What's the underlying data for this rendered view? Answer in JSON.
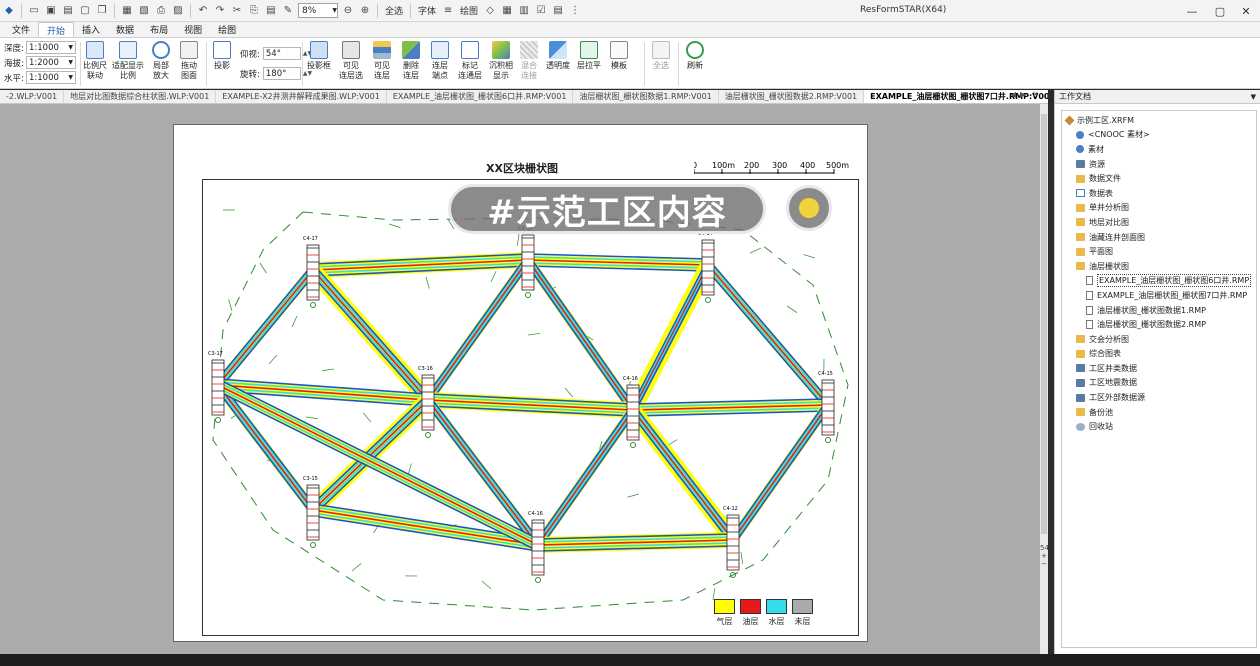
{
  "app": {
    "title": "ResFormSTAR(X64)"
  },
  "toolbar": {
    "zoom": "8%",
    "select_all": "全选",
    "font": "字体",
    "draw": "绘图"
  },
  "menu": {
    "tabs": [
      "文件",
      "开始",
      "插入",
      "数据",
      "布局",
      "视图",
      "绘图"
    ],
    "active": 1
  },
  "ribbon": {
    "depth_label": "深度:",
    "depth": "1:1000",
    "elev_label": "海拔:",
    "elev": "1:2000",
    "horiz_label": "水平:",
    "horiz": "1:1000",
    "pitch_label": "仰视:",
    "pitch": "54°",
    "rot_label": "旋转:",
    "rot": "180°",
    "buttons": [
      {
        "l1": "比例尺",
        "l2": "联动"
      },
      {
        "l1": "适配显示",
        "l2": "比例"
      },
      {
        "l1": "局部",
        "l2": "放大"
      },
      {
        "l1": "拖动",
        "l2": "图面"
      },
      {
        "l1": "投影",
        "l2": ""
      },
      {
        "l1": "投影框",
        "l2": ""
      },
      {
        "l1": "可见",
        "l2": "连层选"
      },
      {
        "l1": "可见",
        "l2": "连层"
      },
      {
        "l1": "删除",
        "l2": "连层"
      },
      {
        "l1": "连层",
        "l2": "端点"
      },
      {
        "l1": "标记",
        "l2": "连通层"
      },
      {
        "l1": "沉积相",
        "l2": "显示"
      },
      {
        "l1": "混合",
        "l2": "连接"
      },
      {
        "l1": "透明度",
        "l2": ""
      },
      {
        "l1": "层拉平",
        "l2": ""
      },
      {
        "l1": "模板",
        "l2": ""
      },
      {
        "l1": "全选",
        "l2": ""
      },
      {
        "l1": "刷新",
        "l2": ""
      }
    ]
  },
  "doc_tabs": [
    "-2.WLP:V001",
    "地层对比图数据综合柱状图.WLP:V001",
    "EXAMPLE-X2井测井解释成果图.WLP:V001",
    "EXAMPLE_油层栅状图_栅状图6口井.RMP:V001",
    "油层栅状图_栅状图数据1.RMP:V001",
    "油层栅状图_栅状图数据2.RMP:V001",
    "EXAMPLE_油层栅状图_栅状图7口井.RMP:V001"
  ],
  "canvas": {
    "title": "XX区块栅状图",
    "scale_labels": [
      "0",
      "100m",
      "200",
      "300",
      "400",
      "500m"
    ],
    "overlay_text": "#示范工区内容",
    "wells": [
      "C4-17",
      "C4-16",
      "C4-14",
      "C3-17",
      "C3-16",
      "C4-16",
      "C4-15",
      "C3-15",
      "C4-16",
      "C4-12"
    ],
    "legend": [
      {
        "label": "气层",
        "color": "#ffff00"
      },
      {
        "label": "油层",
        "color": "#e61a1a"
      },
      {
        "label": "水层",
        "color": "#33ddee"
      },
      {
        "label": "未层",
        "color": "#aaaaaa"
      }
    ],
    "zoom_side": "54"
  },
  "panel": {
    "title": "工作文档",
    "tree": [
      {
        "label": "示例工区.XRFM",
        "icon": "root",
        "indent": 0
      },
      {
        "label": "<CNOOC 素材>",
        "icon": "gear",
        "indent": 1
      },
      {
        "label": "素材",
        "icon": "gear",
        "indent": 1
      },
      {
        "label": "资源",
        "icon": "db",
        "indent": 1
      },
      {
        "label": "数据文件",
        "icon": "folder",
        "indent": 1
      },
      {
        "label": "数据表",
        "icon": "tbl",
        "indent": 1
      },
      {
        "label": "单井分析图",
        "icon": "folder",
        "indent": 1
      },
      {
        "label": "地层对比图",
        "icon": "folder",
        "indent": 1
      },
      {
        "label": "油藏连井剖面图",
        "icon": "folder",
        "indent": 1
      },
      {
        "label": "平面图",
        "icon": "folder",
        "indent": 1
      },
      {
        "label": "油层栅状图",
        "icon": "folder",
        "indent": 1
      },
      {
        "label": "EXAMPLE_油层栅状图_栅状图6口井.RMP",
        "icon": "file",
        "indent": 2,
        "selected": true
      },
      {
        "label": "EXAMPLE_油层栅状图_栅状图7口井.RMP",
        "icon": "file",
        "indent": 2
      },
      {
        "label": "油层栅状图_栅状图数据1.RMP",
        "icon": "file",
        "indent": 2
      },
      {
        "label": "油层栅状图_栅状图数据2.RMP",
        "icon": "file",
        "indent": 2
      },
      {
        "label": "交会分析图",
        "icon": "folder",
        "indent": 1
      },
      {
        "label": "综合图表",
        "icon": "folder",
        "indent": 1
      },
      {
        "label": "工区井类数据",
        "icon": "db",
        "indent": 1
      },
      {
        "label": "工区地震数据",
        "icon": "db",
        "indent": 1
      },
      {
        "label": "工区外部数据源",
        "icon": "db",
        "indent": 1
      },
      {
        "label": "备份池",
        "icon": "folder",
        "indent": 1
      },
      {
        "label": "回收站",
        "icon": "bin",
        "indent": 1
      }
    ]
  }
}
